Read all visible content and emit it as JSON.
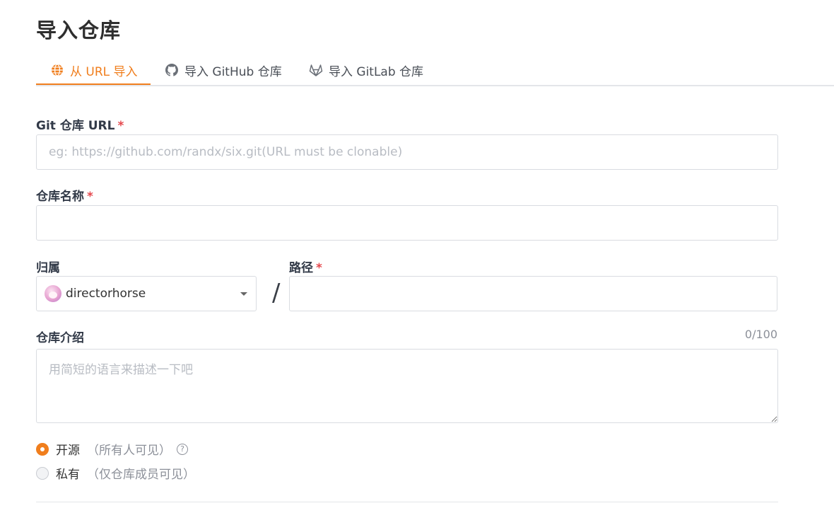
{
  "page": {
    "title": "导入仓库"
  },
  "tabs": [
    {
      "label": "从 URL 导入",
      "icon": "globe-icon",
      "active": true
    },
    {
      "label": "导入 GitHub 仓库",
      "icon": "github-icon",
      "active": false
    },
    {
      "label": "导入 GitLab 仓库",
      "icon": "gitlab-icon",
      "active": false
    }
  ],
  "form": {
    "git_url": {
      "label": "Git 仓库 URL",
      "required_mark": "*",
      "value": "",
      "placeholder": "eg: https://github.com/randx/six.git(URL must be clonable)"
    },
    "repo_name": {
      "label": "仓库名称",
      "required_mark": "*",
      "value": "",
      "placeholder": ""
    },
    "owner": {
      "label": "归属",
      "value": "directorhorse",
      "icon": "avatar"
    },
    "separator": "/",
    "path": {
      "label": "路径",
      "required_mark": "*",
      "value": "",
      "placeholder": ""
    },
    "description": {
      "label": "仓库介绍",
      "counter": "0/100",
      "value": "",
      "placeholder": "用简短的语言来描述一下吧"
    },
    "visibility": {
      "options": [
        {
          "label": "开源",
          "hint": "（所有人可见）",
          "checked": true,
          "help_icon": "?"
        },
        {
          "label": "私有",
          "hint": "（仅仓库成员可见）",
          "checked": false
        }
      ]
    }
  },
  "colors": {
    "accent": "#f07e1d",
    "required": "#e5484d",
    "border": "#d9dce1"
  }
}
